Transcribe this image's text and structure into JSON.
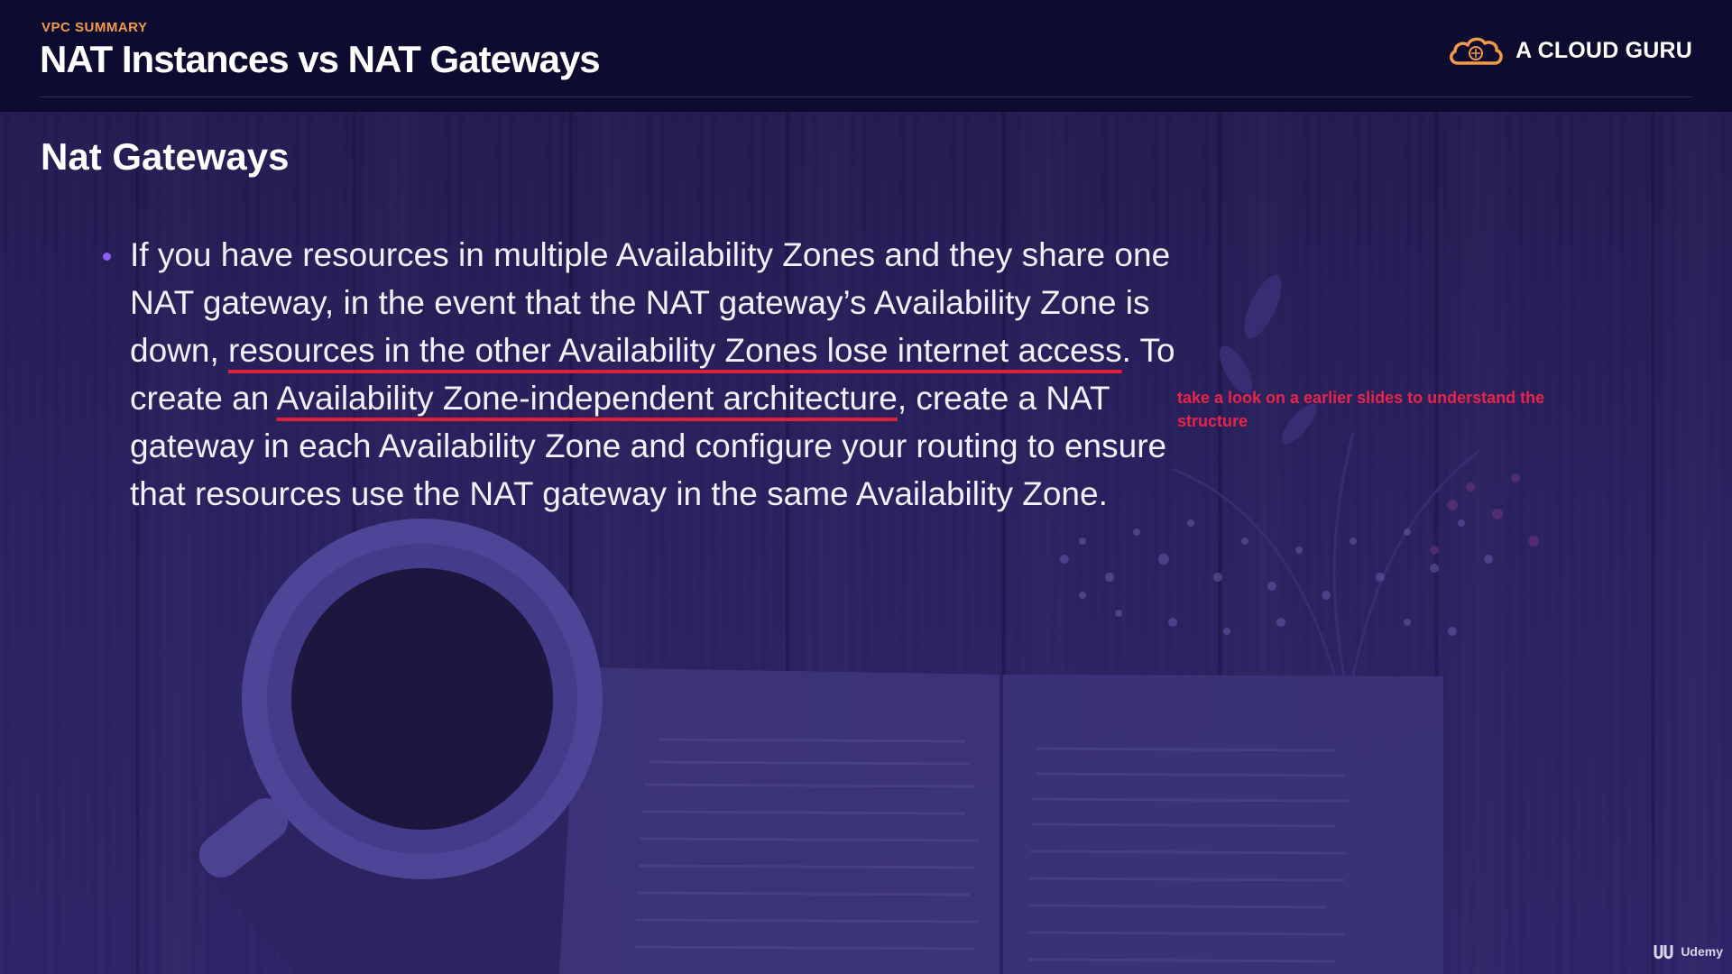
{
  "header": {
    "eyebrow": "VPC SUMMARY",
    "title": "NAT Instances vs NAT Gateways",
    "brand": "A CLOUD GURU",
    "brand_icon": "cloud-logo-icon",
    "accent_color": "#f2994a"
  },
  "main": {
    "heading": "Nat Gateways",
    "bullet": {
      "seg1": "If you have resources in multiple Availability Zones and they share one NAT gateway, in the event that the NAT gateway’s Availability Zone is down, ",
      "underline1": "resources in the other Availability Zones lose internet access",
      "seg2": ". To create an ",
      "underline2": "Availability Zone-independent architecture",
      "seg3": ", create a NAT gateway in each Availability Zone and configure your routing to ensure that resources use the NAT gateway in the same Availability Zone."
    },
    "annotation": "take a look on a earlier slides to understand the structure",
    "annotation_color": "#e8244a",
    "underline_color": "#e0203a"
  },
  "watermark": {
    "label": "Udemy",
    "icon": "udemy-logo-icon"
  }
}
